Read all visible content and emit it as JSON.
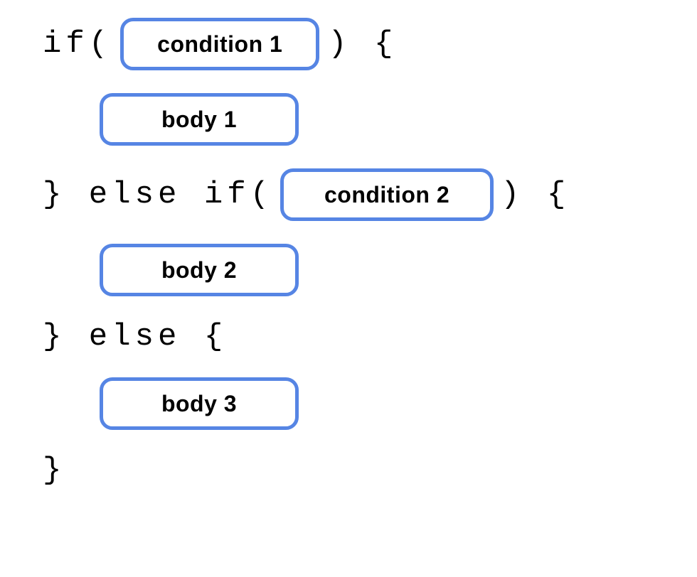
{
  "code": {
    "if": "if(",
    "close_paren_brace": ") {",
    "else_if": "} else if(",
    "else": "} else {",
    "close_brace": "}"
  },
  "placeholders": {
    "condition1": "condition 1",
    "body1": "body 1",
    "condition2": "condition 2",
    "body2": "body 2",
    "body3": "body 3"
  }
}
